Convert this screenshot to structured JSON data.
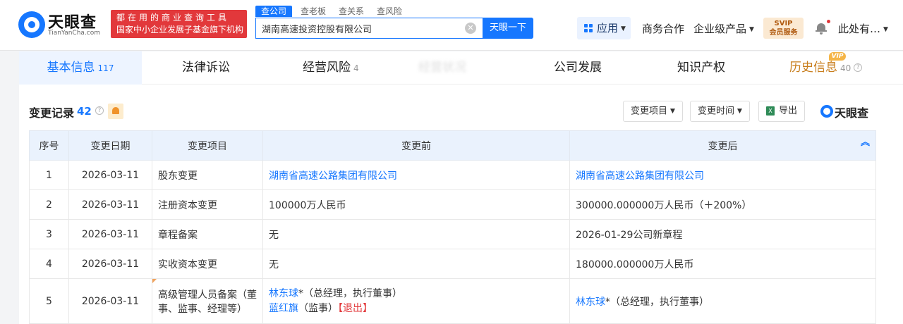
{
  "header": {
    "logo_cn": "天眼查",
    "logo_en": "TianYanCha.com",
    "slogan_line1": "都在用的商业查询工具",
    "slogan_line2": "国家中小企业发展子基金旗下机构",
    "search_tabs": [
      "查公司",
      "查老板",
      "查关系",
      "查风险"
    ],
    "search_value": "湖南高速投资控股有限公司",
    "search_button": "天眼一下",
    "clear_glyph": "✕",
    "app_menu": "应用",
    "nav": [
      "商务合作",
      "企业级产品"
    ],
    "vip_line1": "SVIP",
    "vip_line2": "会员服务",
    "user": "此处有…"
  },
  "main_tabs": [
    {
      "label": "基本信息",
      "count": "117"
    },
    {
      "label": "法律诉讼",
      "count": ""
    },
    {
      "label": "经营风险",
      "count": "4"
    },
    {
      "label": "经营状况",
      "count": ""
    },
    {
      "label": "公司发展",
      "count": ""
    },
    {
      "label": "知识产权",
      "count": ""
    },
    {
      "label": "历史信息",
      "count": "40"
    }
  ],
  "vip_tag": "VIP",
  "section": {
    "title": "变更记录",
    "count": "42",
    "filter_item": "变更项目",
    "filter_time": "变更时间",
    "export": "导出",
    "brand": "天眼查"
  },
  "table": {
    "headers": [
      "序号",
      "变更日期",
      "变更项目",
      "变更前",
      "变更后"
    ],
    "rows": [
      {
        "no": "1",
        "date": "2026-03-11",
        "item": "股东变更",
        "before": [
          "湖南省高速公路集团有限公司"
        ],
        "after": "湖南省高速公路集团有限公司"
      },
      {
        "no": "2",
        "date": "2026-03-11",
        "item": "注册资本变更",
        "before": [
          "100000万人民币"
        ],
        "after": "300000.000000万人民币（＋200%）"
      },
      {
        "no": "3",
        "date": "2026-03-11",
        "item": "章程备案",
        "before": [
          "无"
        ],
        "after": "2026-01-29公司新章程"
      },
      {
        "no": "4",
        "date": "2026-03-11",
        "item": "实收资本变更",
        "before": [
          "无"
        ],
        "after": "180000.000000万人民币"
      },
      {
        "no": "5",
        "date": "2026-03-11",
        "item": "高级管理人员备案（董事、监事、经理等）",
        "before_p1_name": "林东球",
        "before_p1_role": "*（总经理，执行董事）",
        "before_p2_name": "蓝红旗",
        "before_p2_role": "（监事）",
        "before_p2_tag": "【退出】",
        "after_name": "林东球",
        "after_role": "*（总经理，执行董事）"
      }
    ]
  },
  "colors": {
    "accent": "#1677ff",
    "danger": "#e2383b",
    "vip": "#c87e1d"
  }
}
